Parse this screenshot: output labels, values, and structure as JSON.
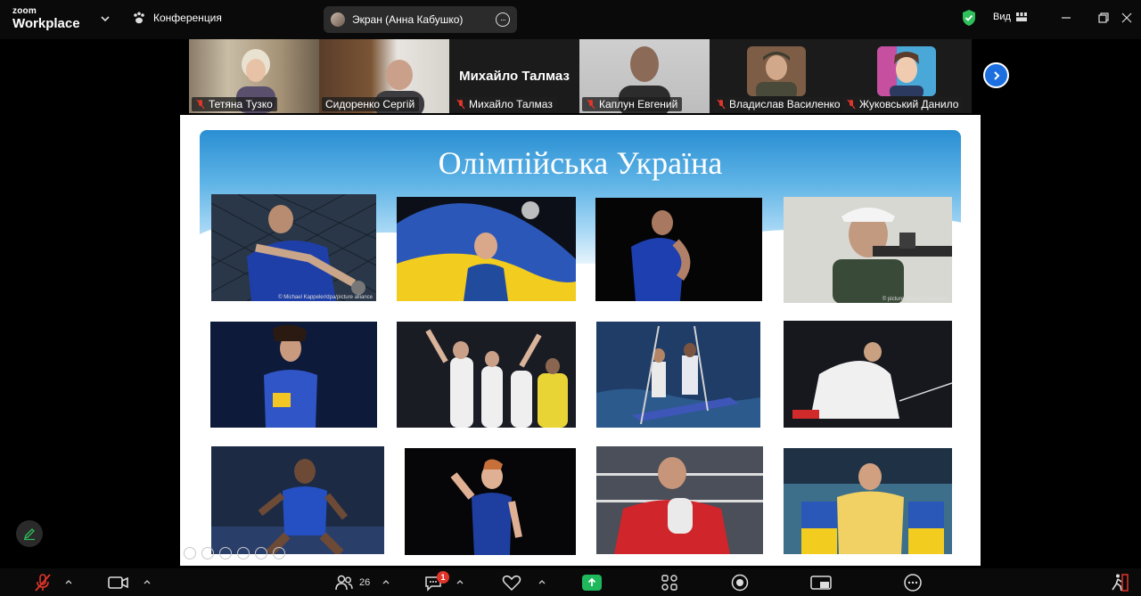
{
  "app": {
    "logo_line1": "zoom",
    "logo_line2": "Workplace"
  },
  "header": {
    "conference_label": "Конференция",
    "screen_share_label": "Экран (Анна Кабушко)",
    "view_label": "Вид"
  },
  "participants": [
    {
      "name": "Тетяна Тузко",
      "muted": true
    },
    {
      "name": "Сидоренко Сергій",
      "muted": false,
      "active": true
    },
    {
      "name": "Михайло Талмаз",
      "display_name": "Михайло Талмаз",
      "muted": true
    },
    {
      "name": "Каплун Евгений",
      "muted": true
    },
    {
      "name": "Владислав Василенко",
      "muted": true
    },
    {
      "name": "Жуковський Данило",
      "muted": true
    }
  ],
  "slide": {
    "title": "Олімпійська Україна",
    "photo_credit_1": "© Michael Kappeler/dpa/picture alliance",
    "photo_credit_4": "© picture alliance/Newscom"
  },
  "toolbar": {
    "participants_count": "26",
    "chat_badge": "1"
  },
  "colors": {
    "accent_green": "#32c46b",
    "share_green": "#1fb85c",
    "next_blue": "#1d6fe0",
    "muted_red": "#e0352b",
    "banner_blue": "#2a8fd3"
  }
}
